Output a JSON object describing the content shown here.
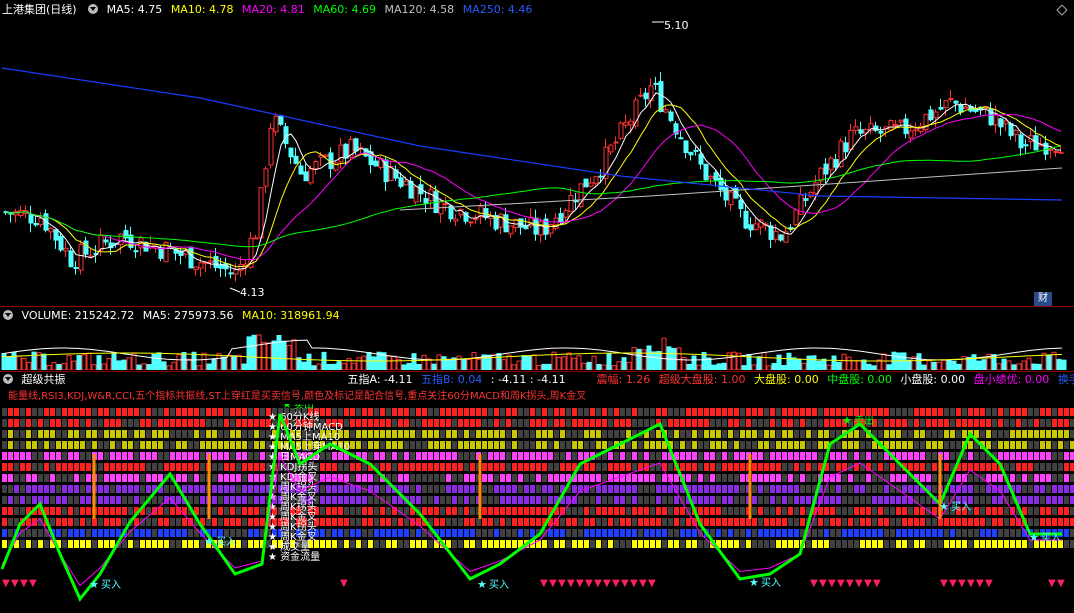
{
  "price_header": {
    "title": "上港集团(日线)",
    "ma5": "MA5: 4.75",
    "ma10": "MA10: 4.78",
    "ma20": "MA20: 4.81",
    "ma60": "MA60: 4.69",
    "ma120": "MA120: 4.58",
    "ma250": "MA250: 4.46"
  },
  "price_labels": {
    "high": "5.10",
    "low": "4.13",
    "fin_badge": "财"
  },
  "volume_header": {
    "volume": "VOLUME: 215242.72",
    "ma5": "MA5: 275973.56",
    "ma10": "MA10: 318961.94"
  },
  "indicator_header": {
    "title": "超级共振",
    "wuzhi_a": "五指A: -4.11",
    "wuzhi_b": "五指B: 0.04",
    "wuzhi_c": ": -4.11",
    "wuzhi_d": ": -4.11",
    "zhenfu": "震幅: 1.26",
    "chaoji_dapan": "超级大盘股: 1.00",
    "dapan": "大盘股: 0.00",
    "zhongpan": "中盘股: 0.00",
    "xiaopan": "小盘股: 0.00",
    "xiaopan_jy": "盘小绩优: 0.00",
    "huanshou": "换手"
  },
  "indicator_note": "能量线,RSI3,KDJ,W&R,CCI,五个指标共振线,ST上穿红是买卖信号,颜色及标记是配合信号,重点关注60分MACD和周K拐头,周K金叉",
  "row_labels": [
    "★ 60分K线",
    "★ 60分钟MACD",
    "★ MA5上MA10",
    "★ MA5上穿MA10",
    "★ 日MACD",
    "★ KDJ拐头",
    "★ KDJ金叉",
    "★ 周K拐头",
    "★ 周K金叉",
    "★ 周K拐头",
    "★ 周K金叉",
    "★ 周K拐头",
    "★ 周K金叉",
    "★ 成交量",
    "★ 资金流量"
  ],
  "signals": {
    "buy": "买入",
    "sell": "卖出"
  },
  "colors": {
    "bg": "#000000",
    "up": "#ff3232",
    "down": "#54ffff",
    "ma5": "#ffffff",
    "ma10": "#ffff00",
    "ma20": "#ff00ff",
    "ma60": "#00ff00",
    "ma120": "#c0c0c0",
    "ma250": "#1a3cff"
  }
}
